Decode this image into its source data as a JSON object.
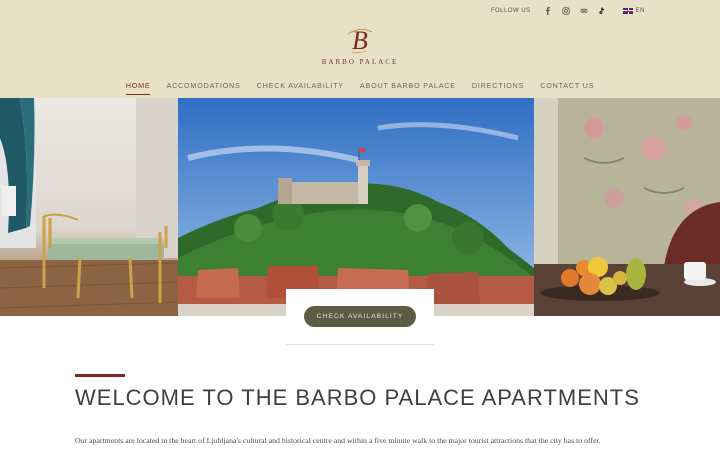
{
  "topbar": {
    "follow_label": "FOLLOW US",
    "social": [
      "facebook-icon",
      "instagram-icon",
      "tripadvisor-icon",
      "tiktok-icon"
    ],
    "language": "EN"
  },
  "logo": {
    "mark": "B",
    "name": "BARBO PALACE"
  },
  "nav": {
    "items": [
      {
        "label": "HOME",
        "active": true
      },
      {
        "label": "ACCOMODATIONS",
        "active": false
      },
      {
        "label": "CHECK AVAILABILITY",
        "active": false
      },
      {
        "label": "ABOUT BARBO PALACE",
        "active": false
      },
      {
        "label": "DIRECTIONS",
        "active": false
      },
      {
        "label": "CONTACT US",
        "active": false
      }
    ]
  },
  "hero": {
    "cta_label": "CHECK AVAILABILITY"
  },
  "main": {
    "heading": "WELCOME TO THE BARBO PALACE APARTMENTS",
    "intro": "Our apartments are located in the heart of Ljubljana's cultural and historical centre and within a five minute walk to the major tourist attractions that the city has to offer."
  },
  "colors": {
    "header_bg": "#e8e1c6",
    "accent": "#7b2a24",
    "button_bg": "#5c5b44"
  }
}
